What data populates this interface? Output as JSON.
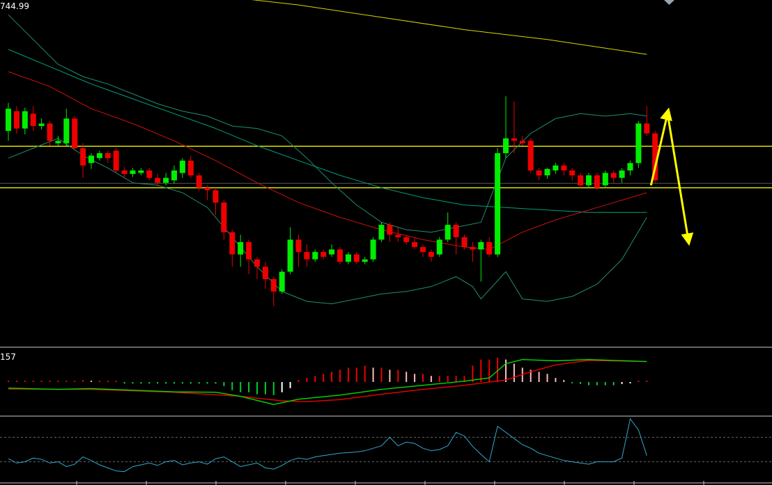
{
  "labels": {
    "price": "744.99",
    "macd": "157"
  },
  "colors": {
    "background": "#000000",
    "bull": "#00ee00",
    "bear": "#ee0000",
    "ma_slow": "#d8d800",
    "ma_mid": "#00a080",
    "ma_fast": "#cc1111",
    "bollinger": "#1f8f70",
    "hline": "#f0f000",
    "arrow": "#ffff00",
    "macd_dif": "#00dd00",
    "macd_dea": "#ee0000",
    "hist_up": "#ee0000",
    "hist_up_weak": "#ffbbbb",
    "hist_down": "#00cc33",
    "hist_down_weak": "#ffffff",
    "osc": "#33aacc"
  },
  "icons": {
    "top_marker": "diamond-icon"
  },
  "chart_data": [
    {
      "type": "candlestick",
      "x_count": 78,
      "ylim": [
        690,
        760
      ],
      "last_label": "744.99",
      "candles": [
        [
          733.5,
          738.0,
          731.5,
          739.2
        ],
        [
          737.5,
          734.0,
          733.0,
          738.5
        ],
        [
          734.0,
          737.5,
          732.8,
          738.2
        ],
        [
          737.0,
          734.5,
          733.5,
          738.5
        ],
        [
          734.5,
          735.0,
          733.8,
          736.0
        ],
        [
          735.0,
          731.5,
          730.5,
          735.5
        ],
        [
          731.0,
          731.5,
          730.5,
          732.5
        ],
        [
          731.0,
          736.0,
          730.5,
          738.0
        ],
        [
          736.0,
          730.0,
          729.5,
          736.5
        ],
        [
          730.0,
          726.5,
          724.0,
          731.0
        ],
        [
          727.0,
          728.5,
          725.8,
          729.0
        ],
        [
          728.0,
          729.0,
          727.5,
          729.5
        ],
        [
          729.0,
          728.0,
          727.0,
          729.5
        ],
        [
          729.5,
          725.5,
          725.0,
          730.0
        ],
        [
          725.5,
          724.8,
          724.0,
          726.2
        ],
        [
          724.8,
          725.5,
          724.2,
          726.0
        ],
        [
          725.0,
          725.5,
          724.5,
          726.0
        ],
        [
          725.5,
          724.0,
          723.5,
          726.0
        ],
        [
          724.0,
          723.0,
          722.5,
          724.8
        ],
        [
          723.0,
          724.0,
          722.5,
          725.0
        ],
        [
          723.5,
          725.5,
          722.8,
          726.5
        ],
        [
          725.0,
          727.5,
          724.0,
          728.0
        ],
        [
          727.5,
          724.5,
          724.0,
          728.5
        ],
        [
          724.5,
          722.0,
          721.5,
          725.0
        ],
        [
          722.0,
          721.5,
          719.5,
          722.5
        ],
        [
          721.5,
          719.0,
          716.5,
          722.0
        ],
        [
          719.0,
          713.0,
          711.5,
          719.5
        ],
        [
          713.0,
          708.5,
          706.0,
          713.5
        ],
        [
          708.5,
          711.0,
          706.0,
          712.5
        ],
        [
          711.0,
          707.5,
          704.5,
          711.5
        ],
        [
          707.5,
          706.0,
          703.5,
          708.0
        ],
        [
          706.0,
          703.5,
          701.5,
          707.0
        ],
        [
          703.5,
          701.0,
          698.0,
          704.0
        ],
        [
          701.0,
          705.0,
          700.5,
          705.5
        ],
        [
          705.0,
          711.5,
          704.5,
          714.0
        ],
        [
          711.5,
          709.0,
          706.0,
          712.5
        ],
        [
          709.0,
          707.5,
          706.0,
          710.5
        ],
        [
          707.5,
          709.0,
          707.0,
          709.5
        ],
        [
          709.0,
          708.0,
          707.5,
          709.5
        ],
        [
          708.5,
          709.5,
          708.0,
          710.5
        ],
        [
          709.5,
          707.0,
          706.5,
          710.0
        ],
        [
          707.0,
          708.5,
          706.5,
          709.0
        ],
        [
          708.5,
          707.0,
          706.5,
          709.0
        ],
        [
          707.0,
          707.5,
          706.5,
          708.0
        ],
        [
          707.5,
          711.5,
          707.0,
          712.0
        ],
        [
          711.5,
          714.5,
          711.0,
          715.0
        ],
        [
          714.5,
          712.5,
          711.0,
          715.0
        ],
        [
          712.5,
          712.0,
          711.0,
          714.0
        ],
        [
          712.0,
          711.0,
          710.5,
          712.5
        ],
        [
          711.0,
          710.0,
          709.5,
          712.0
        ],
        [
          710.0,
          709.0,
          708.0,
          710.5
        ],
        [
          709.0,
          708.0,
          707.0,
          709.5
        ],
        [
          708.5,
          711.5,
          708.0,
          712.0
        ],
        [
          711.5,
          714.5,
          711.0,
          717.0
        ],
        [
          714.5,
          712.0,
          708.5,
          715.0
        ],
        [
          712.0,
          710.0,
          709.5,
          712.5
        ],
        [
          710.0,
          709.5,
          707.0,
          711.0
        ],
        [
          709.5,
          711.0,
          703.0,
          711.5
        ],
        [
          711.0,
          708.5,
          708.0,
          712.0
        ],
        [
          708.5,
          729.0,
          708.0,
          730.0
        ],
        [
          729.0,
          732.0,
          728.0,
          740.5
        ],
        [
          732.0,
          731.5,
          729.0,
          739.5
        ],
        [
          731.5,
          731.0,
          730.5,
          732.5
        ],
        [
          731.5,
          725.5,
          725.0,
          732.0
        ],
        [
          725.5,
          724.5,
          723.5,
          726.0
        ],
        [
          724.5,
          725.8,
          723.8,
          726.0
        ],
        [
          725.5,
          726.5,
          724.8,
          727.0
        ],
        [
          726.5,
          725.5,
          724.5,
          727.0
        ],
        [
          725.5,
          724.5,
          723.5,
          726.0
        ],
        [
          724.5,
          722.5,
          722.0,
          725.0
        ],
        [
          722.5,
          724.5,
          722.0,
          725.0
        ],
        [
          724.5,
          722.0,
          721.5,
          725.0
        ],
        [
          722.5,
          725.0,
          722.0,
          725.5
        ],
        [
          725.0,
          724.0,
          723.0,
          725.5
        ],
        [
          724.0,
          725.5,
          723.0,
          726.0
        ],
        [
          725.5,
          727.0,
          724.5,
          727.5
        ],
        [
          727.0,
          735.0,
          726.0,
          735.5
        ],
        [
          735.0,
          733.0,
          732.5,
          738.5
        ],
        [
          733.0,
          723.5,
          723.0,
          733.5
        ]
      ],
      "ma_fast": [
        [
          0,
          745.5
        ],
        [
          5,
          742.5
        ],
        [
          10,
          738.0
        ],
        [
          15,
          735.0
        ],
        [
          20,
          731.5
        ],
        [
          25,
          727.5
        ],
        [
          30,
          723.0
        ],
        [
          35,
          719.0
        ],
        [
          40,
          716.0
        ],
        [
          45,
          713.5
        ],
        [
          50,
          711.5
        ],
        [
          55,
          710.0
        ],
        [
          58,
          709.5
        ],
        [
          62,
          713.0
        ],
        [
          66,
          715.5
        ],
        [
          70,
          717.5
        ],
        [
          74,
          719.5
        ],
        [
          77,
          721.0
        ]
      ],
      "ma_mid": [
        [
          0,
          750.0
        ],
        [
          5,
          746.5
        ],
        [
          10,
          743.0
        ],
        [
          15,
          740.0
        ],
        [
          20,
          737.0
        ],
        [
          25,
          734.0
        ],
        [
          30,
          730.5
        ],
        [
          35,
          727.5
        ],
        [
          40,
          724.5
        ],
        [
          45,
          722.0
        ],
        [
          50,
          720.0
        ],
        [
          55,
          718.5
        ],
        [
          60,
          718.0
        ],
        [
          65,
          717.5
        ],
        [
          70,
          717.0
        ],
        [
          77,
          717.0
        ]
      ],
      "ma_slow": [
        [
          27,
          760.5
        ],
        [
          35,
          759.0
        ],
        [
          45,
          756.5
        ],
        [
          55,
          754.0
        ],
        [
          65,
          752.0
        ],
        [
          77,
          749.0
        ]
      ],
      "boll_upper": [
        [
          0,
          757.0
        ],
        [
          3,
          752.0
        ],
        [
          6,
          747.0
        ],
        [
          9,
          744.5
        ],
        [
          12,
          743.0
        ],
        [
          15,
          741.0
        ],
        [
          18,
          739.0
        ],
        [
          21,
          737.5
        ],
        [
          24,
          736.5
        ],
        [
          27,
          734.5
        ],
        [
          30,
          734.0
        ],
        [
          33,
          732.5
        ],
        [
          36,
          728.0
        ],
        [
          39,
          723.0
        ],
        [
          42,
          718.5
        ],
        [
          45,
          715.0
        ],
        [
          48,
          713.5
        ],
        [
          51,
          713.0
        ],
        [
          54,
          714.0
        ],
        [
          57,
          715.0
        ],
        [
          60,
          728.0
        ],
        [
          63,
          733.0
        ],
        [
          66,
          736.0
        ],
        [
          69,
          737.0
        ],
        [
          72,
          736.5
        ],
        [
          75,
          737.0
        ],
        [
          77,
          736.5
        ]
      ],
      "boll_lower": [
        [
          0,
          728.0
        ],
        [
          3,
          730.0
        ],
        [
          6,
          732.0
        ],
        [
          9,
          728.5
        ],
        [
          12,
          726.0
        ],
        [
          15,
          723.0
        ],
        [
          18,
          722.5
        ],
        [
          21,
          721.0
        ],
        [
          24,
          718.0
        ],
        [
          27,
          712.0
        ],
        [
          30,
          706.0
        ],
        [
          33,
          701.0
        ],
        [
          36,
          699.0
        ],
        [
          39,
          698.5
        ],
        [
          42,
          699.5
        ],
        [
          45,
          700.5
        ],
        [
          48,
          701.0
        ],
        [
          51,
          702.0
        ],
        [
          54,
          704.0
        ],
        [
          56,
          702.0
        ],
        [
          57,
          699.5
        ],
        [
          60,
          705.0
        ],
        [
          62,
          699.5
        ],
        [
          65,
          699.0
        ],
        [
          68,
          700.0
        ],
        [
          71,
          702.5
        ],
        [
          74,
          707.5
        ],
        [
          77,
          716.0
        ]
      ],
      "hlines": [
        730.4,
        722.0,
        722.9
      ],
      "arrows": [
        {
          "from": [
            77.5,
            722.5
          ],
          "to": [
            79.5,
            737.0
          ]
        },
        {
          "from": [
            79.5,
            737.0
          ],
          "to": [
            82.0,
            711.5
          ]
        }
      ]
    },
    {
      "type": "bar",
      "x_count": 78,
      "ylim": [
        -8,
        8
      ],
      "series": [
        {
          "values": [
            0.2,
            0.2,
            0.2,
            0.2,
            0.2,
            0.2,
            0.2,
            0.3,
            0.3,
            0.5,
            0.2,
            0.2,
            0.2,
            0.2,
            -0.4,
            -0.4,
            -0.4,
            -0.4,
            -0.4,
            -0.4,
            -0.4,
            -0.4,
            -0.4,
            -0.4,
            -0.4,
            -0.4,
            -1.0,
            -2.0,
            -2.5,
            -2.5,
            -3.0,
            -3.0,
            -3.2,
            -2.5,
            -1.5,
            0.5,
            1.0,
            1.5,
            2.0,
            2.5,
            3.0,
            3.5,
            3.5,
            4.0,
            3.5,
            3.5,
            3.0,
            3.0,
            2.5,
            2.0,
            2.0,
            1.5,
            1.5,
            1.5,
            1.5,
            1.5,
            4.0,
            5.5,
            5.5,
            6.0,
            5.5,
            4.5,
            3.5,
            3.0,
            2.5,
            2.0,
            1.0,
            0.5,
            -0.3,
            -0.5,
            -0.8,
            -0.8,
            -0.8,
            -0.8,
            -0.5,
            -0.3,
            0.2,
            0.3
          ]
        }
      ],
      "dif": [
        [
          0,
          -1.5
        ],
        [
          6,
          -1.8
        ],
        [
          10,
          -1.6
        ],
        [
          15,
          -2.0
        ],
        [
          20,
          -2.4
        ],
        [
          25,
          -2.5
        ],
        [
          28,
          -3.5
        ],
        [
          32,
          -5.5
        ],
        [
          35,
          -4.2
        ],
        [
          40,
          -3.2
        ],
        [
          45,
          -1.8
        ],
        [
          50,
          -0.8
        ],
        [
          55,
          0.2
        ],
        [
          58,
          1.0
        ],
        [
          60,
          4.5
        ],
        [
          62,
          5.5
        ],
        [
          66,
          5.2
        ],
        [
          70,
          5.5
        ],
        [
          77,
          5.0
        ]
      ],
      "dea": [
        [
          0,
          -1.7
        ],
        [
          10,
          -1.8
        ],
        [
          20,
          -2.5
        ],
        [
          28,
          -3.5
        ],
        [
          33,
          -4.6
        ],
        [
          36,
          -4.8
        ],
        [
          40,
          -4.3
        ],
        [
          45,
          -3.0
        ],
        [
          50,
          -1.8
        ],
        [
          55,
          -0.8
        ],
        [
          60,
          0.5
        ],
        [
          63,
          2.5
        ],
        [
          66,
          4.2
        ],
        [
          70,
          5.3
        ],
        [
          77,
          5.0
        ]
      ],
      "label": "157"
    },
    {
      "type": "line",
      "x_count": 78,
      "ylim": [
        0,
        100
      ],
      "levels": [
        70,
        30
      ],
      "series": [
        {
          "values": [
            35,
            28,
            30,
            36,
            34,
            28,
            30,
            22,
            26,
            38,
            32,
            25,
            20,
            15,
            14,
            22,
            25,
            28,
            24,
            30,
            32,
            25,
            28,
            30,
            26,
            35,
            38,
            30,
            22,
            25,
            28,
            20,
            18,
            24,
            32,
            36,
            34,
            38,
            40,
            42,
            44,
            45,
            46,
            48,
            52,
            56,
            70,
            56,
            62,
            60,
            52,
            48,
            50,
            56,
            78,
            72,
            55,
            42,
            30,
            88,
            78,
            68,
            58,
            52,
            44,
            40,
            36,
            32,
            30,
            28,
            26,
            30,
            30,
            30,
            36,
            100,
            82,
            40
          ]
        }
      ]
    }
  ]
}
